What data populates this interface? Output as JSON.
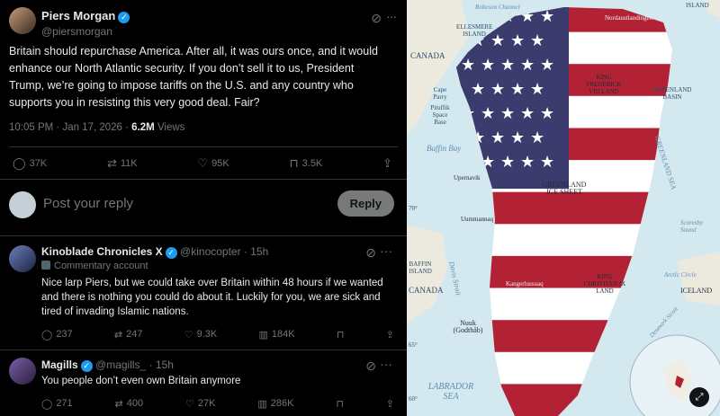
{
  "post": {
    "author_name": "Piers Morgan",
    "author_handle": "@piersmorgan",
    "text": "Britain should repurchase America. After all, it was ours once, and it would enhance our North Atlantic security. If you don’t sell it to us, President Trump, we’re going to impose tariffs on the U.S. and any country who supports you in resisting this very good deal. Fair?",
    "timestamp": "10:05 PM · Jan 17, 2026 · ",
    "views_count": "6.2M",
    "views_label": " Views",
    "replies": "37K",
    "reposts": "11K",
    "likes": "95K",
    "bookmarks": "3.5K"
  },
  "composer": {
    "placeholder": "Post your reply",
    "reply_button": "Reply"
  },
  "replies": [
    {
      "author_name": "Kinoblade Chronicles X",
      "author_handle": "@kinocopter",
      "time": "· 15h",
      "badge": "Commentary account",
      "text": "Nice larp Piers, but we could take over Britain within 48 hours if we wanted and there is nothing you could do about it. Luckily for you, we are sick and tired of invading Islamic nations.",
      "replies": "237",
      "reposts": "247",
      "likes": "9.3K",
      "views": "184K"
    },
    {
      "author_name": "Magills",
      "author_handle": "@magills_",
      "time": "· 15h",
      "text": "You people don’t even own Britain anymore",
      "replies": "271",
      "reposts": "400",
      "likes": "27K",
      "views": "286K"
    }
  ],
  "map": {
    "labels": {
      "ellesmere": "ELLESMERE ISLAND",
      "canada_top": "CANADA",
      "cape_parry": "Cape Parry",
      "pituffik": "Pituffik Space Base",
      "baffin_bay": "Baffin Bay",
      "upernavik": "Upernavik",
      "uummannaq": "Uummannaq",
      "greenland_ice": "GREENLAND ICE SHEET",
      "king_frederick": "KING FREDERICK VIII LAND",
      "greenland_basin": "GREENLAND BASIN",
      "greenland_sea": "GREENLAND SEA",
      "king_christian_ix": "KING CHRISTIAN IX LAND",
      "canada_bottom": "CANADA",
      "baffin_island": "BAFFIN ISLAND",
      "davis_strait": "Davis Strait",
      "nuuk": "Nuuk (Godthåb)",
      "labrador_sea": "LABRADOR SEA",
      "iceland": "ICELAND",
      "denmark_strait": "Denmark Strait",
      "arctic_circle": "Arctic Circle",
      "scoresby": "Scoresby Sound",
      "island_top": "ISLAND",
      "robeson": "Robeson Channel",
      "nordaustlandet": "Nordaustlandingen",
      "kangerlussuaq": "Kangerlussuaq",
      "lat70": "70°",
      "lat65": "65°",
      "lat60": "60°"
    }
  },
  "colors": {
    "accent": "#1d9bf0",
    "flag_red": "#b22234",
    "flag_blue": "#3c3b6e"
  }
}
